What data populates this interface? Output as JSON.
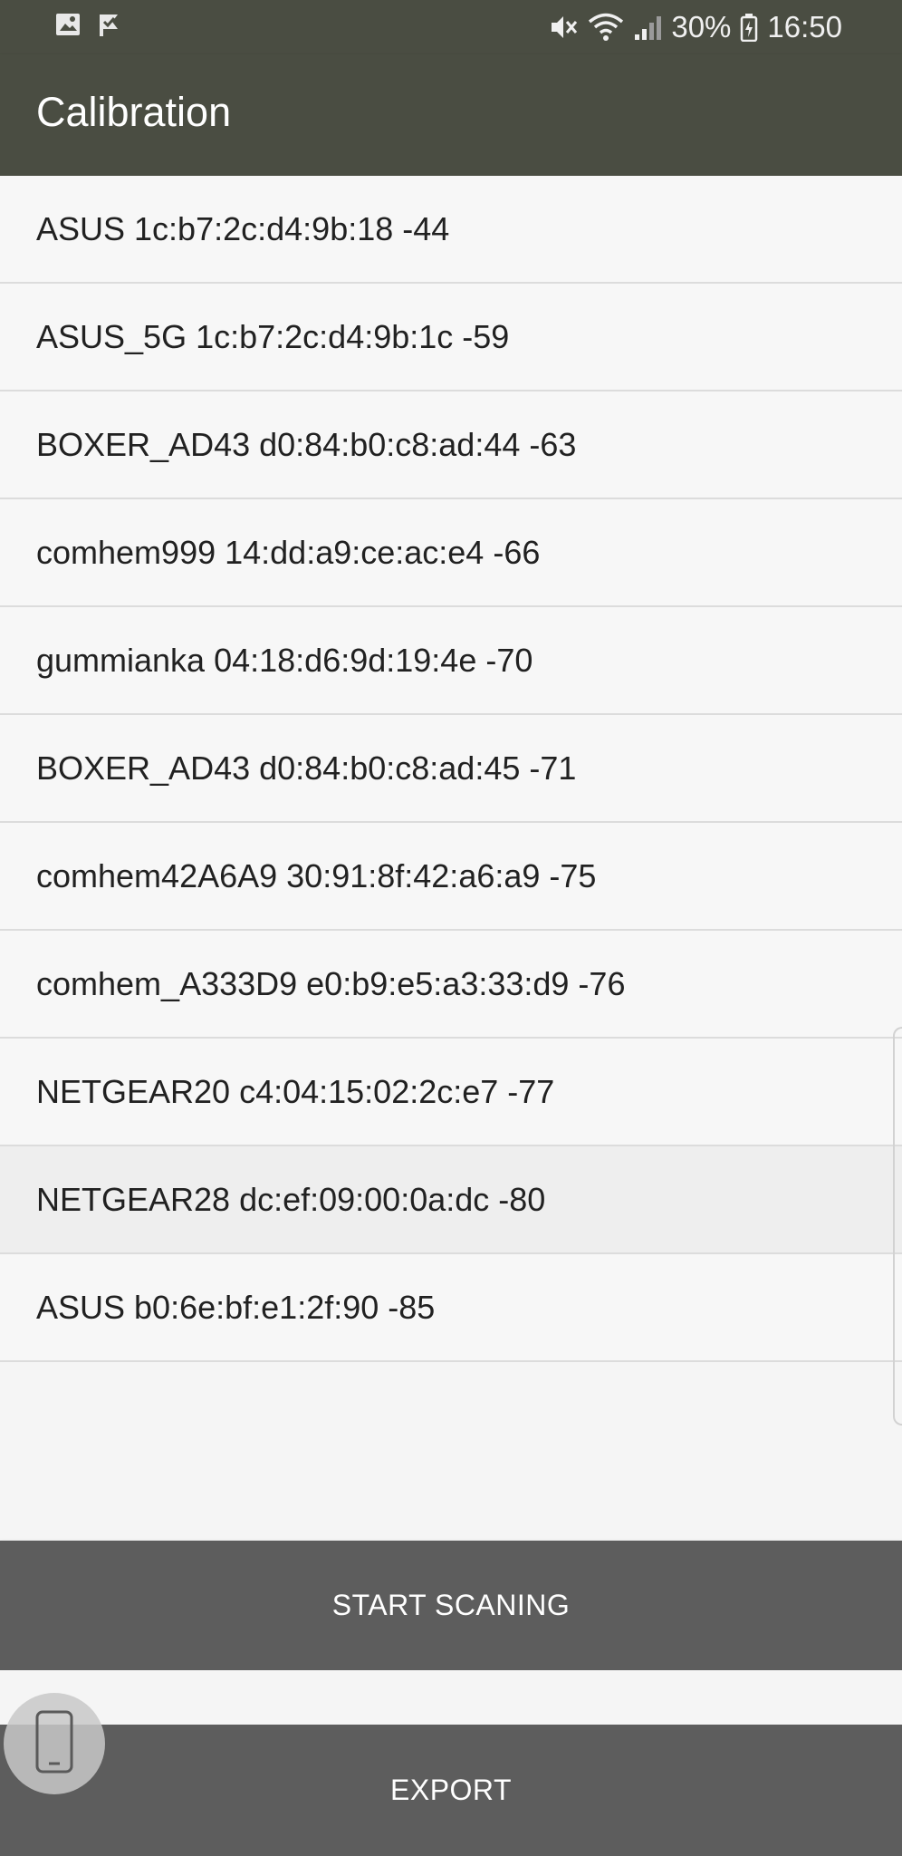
{
  "status_bar": {
    "battery": "30%",
    "time": "16:50",
    "icons": [
      "gallery-icon",
      "check-flag-icon",
      "mute-icon",
      "wifi-icon",
      "signal-icon",
      "battery-icon"
    ]
  },
  "app_bar": {
    "title": "Calibration"
  },
  "networks": [
    "ASUS 1c:b7:2c:d4:9b:18 -44",
    "ASUS_5G 1c:b7:2c:d4:9b:1c -59",
    "BOXER_AD43 d0:84:b0:c8:ad:44 -63",
    "comhem999 14:dd:a9:ce:ac:e4 -66",
    "gummianka 04:18:d6:9d:19:4e -70",
    "BOXER_AD43 d0:84:b0:c8:ad:45 -71",
    "comhem42A6A9 30:91:8f:42:a6:a9 -75",
    "comhem_A333D9 e0:b9:e5:a3:33:d9 -76",
    "NETGEAR20 c4:04:15:02:2c:e7 -77",
    "NETGEAR28 dc:ef:09:00:0a:dc -80",
    "ASUS b0:6e:bf:e1:2f:90 -85"
  ],
  "buttons": {
    "start": "START SCANING",
    "export": "EXPORT"
  },
  "colors": {
    "app_bar": "#4a4d42",
    "button": "#5d5d5d",
    "background": "#f5f5f5"
  }
}
